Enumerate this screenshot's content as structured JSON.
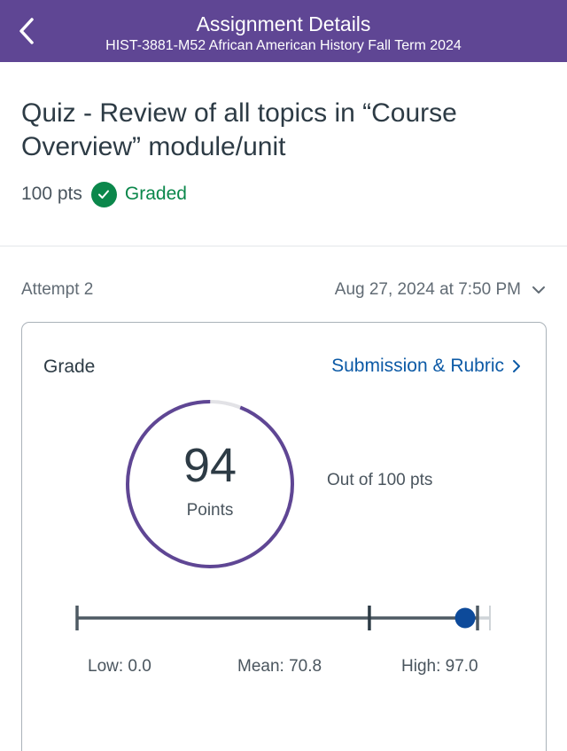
{
  "header": {
    "title": "Assignment Details",
    "course": "HIST-3881-M52 African American History Fall Term 2024",
    "back_icon": "chevron-left-icon",
    "bg_color": "#5f4694"
  },
  "assignment": {
    "title": "Quiz - Review of all topics in “Course Overview” module/unit",
    "points": "100 pts",
    "status": "Graded",
    "status_icon": "check-circle-icon",
    "status_color": "#0b874b"
  },
  "attempt": {
    "label": "Attempt 2",
    "date": "Aug 27, 2024 at 7:50 PM",
    "dropdown_icon": "chevron-down-icon"
  },
  "grade_card": {
    "label": "Grade",
    "link": "Submission & Rubric",
    "link_icon": "chevron-right-icon",
    "score": "94",
    "score_unit": "Points",
    "out_of": "Out of 100 pts",
    "score_fraction": 0.94,
    "ring_color": "#5f4694"
  },
  "stats": {
    "low_label": "Low: 0.0",
    "mean_label": "Mean: 70.8",
    "high_label": "High: 97.0",
    "low": 0.0,
    "mean": 70.8,
    "high": 97.0,
    "score": 94,
    "max": 100,
    "marker_color": "#0d4a9a"
  }
}
